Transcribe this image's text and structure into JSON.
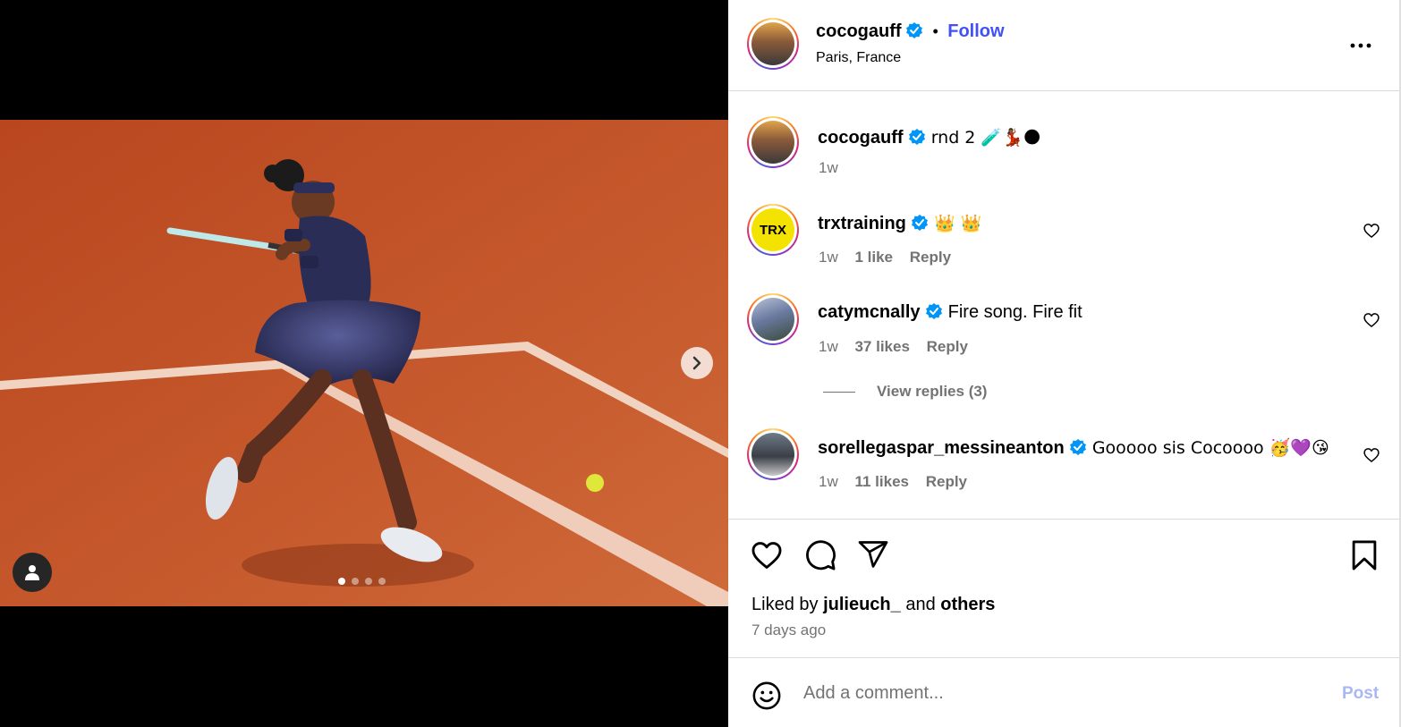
{
  "colors": {
    "follow": "#4150f7",
    "verified": "#0095f6",
    "secondary_text": "#737373",
    "post_disabled": "#a9b7f5",
    "clay_court": "#c4542b"
  },
  "media": {
    "carousel_dots": 4,
    "active_dot": 1
  },
  "header": {
    "username": "cocogauff",
    "separator": "•",
    "follow_label": "Follow",
    "location": "Paris, France"
  },
  "caption": {
    "username": "cocogauff",
    "text": "rnd 2 🧪💃🏾🌑",
    "time": "1w"
  },
  "comments": [
    {
      "username": "trxtraining",
      "text": "👑 👑",
      "time": "1w",
      "likes": "1 like",
      "reply": "Reply",
      "avatar_text": "TRX"
    },
    {
      "username": "catymcnally",
      "text": "Fire song. Fire fit",
      "time": "1w",
      "likes": "37 likes",
      "reply": "Reply"
    },
    {
      "username": "sorellegaspar_messineanton",
      "text": "Gooooo sis Cocoooo 🥳💜😘",
      "time": "1w",
      "likes": "11 likes",
      "reply": "Reply"
    }
  ],
  "view_replies": "View replies (3)",
  "liked_by": {
    "prefix": "Liked by",
    "user": "julieuch_",
    "and": "and",
    "others": "others"
  },
  "posted_ago": "7 days ago",
  "comment_box": {
    "placeholder": "Add a comment...",
    "post_label": "Post"
  }
}
